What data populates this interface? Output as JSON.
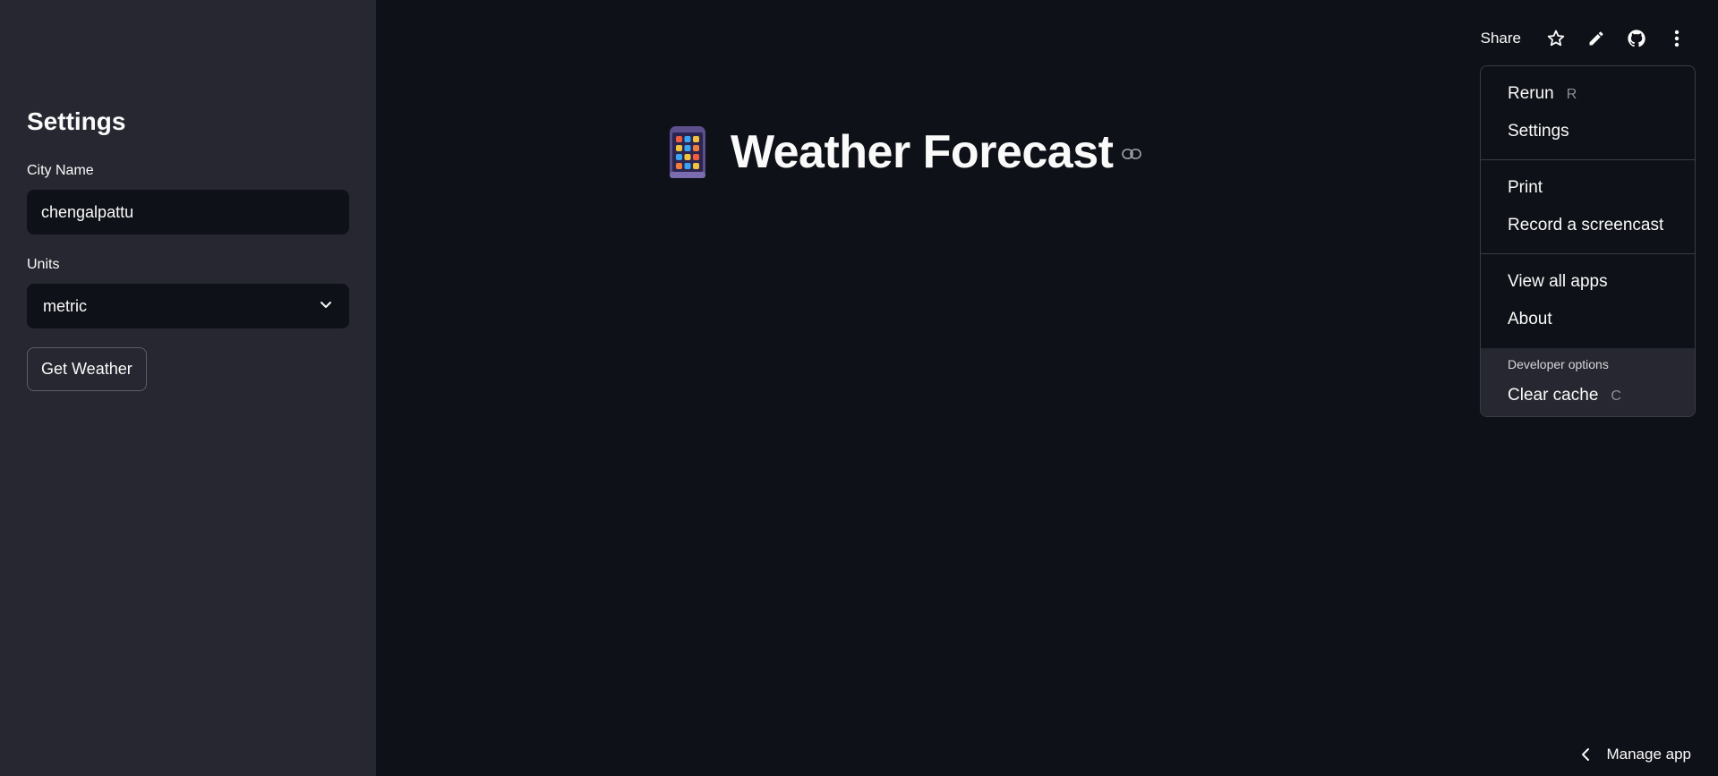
{
  "sidebar": {
    "title": "Settings",
    "city_label": "City Name",
    "city_value": "chengalpattu",
    "units_label": "Units",
    "units_selected": "metric",
    "get_weather_label": "Get Weather"
  },
  "main": {
    "title": "Weather Forecast",
    "title_emoji": "phone-icon"
  },
  "toolbar": {
    "share_label": "Share",
    "icons": [
      "star-icon",
      "pencil-icon",
      "github-icon",
      "more-vert-icon"
    ]
  },
  "menu": {
    "rerun_label": "Rerun",
    "rerun_shortcut": "R",
    "settings_label": "Settings",
    "print_label": "Print",
    "record_label": "Record a screencast",
    "view_all_label": "View all apps",
    "about_label": "About",
    "developer_options_label": "Developer options",
    "clear_cache_label": "Clear cache",
    "clear_cache_shortcut": "C"
  },
  "footer": {
    "manage_app_label": "Manage app"
  },
  "colors": {
    "background": "#0e1117",
    "sidebar": "#262730",
    "text": "#fafafa"
  }
}
